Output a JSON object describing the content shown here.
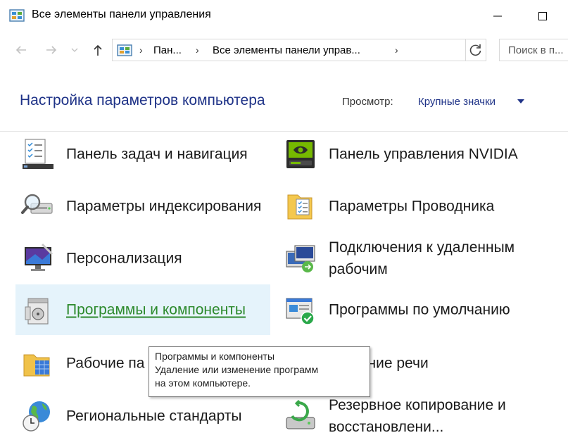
{
  "window": {
    "title": "Все элементы панели управления",
    "icon": "control-panel-icon"
  },
  "navbar": {
    "breadcrumbs": [
      "Пан...",
      "Все элементы панели управ..."
    ],
    "search_placeholder": "Поиск в п..."
  },
  "header": {
    "title": "Настройка параметров компьютера",
    "view_label": "Просмотр:",
    "view_value": "Крупные значки"
  },
  "items_left": [
    {
      "label": "Панель задач и навигация",
      "icon": "taskbar-icon"
    },
    {
      "label": "Параметры индексирования",
      "icon": "indexing-icon"
    },
    {
      "label": "Персонализация",
      "icon": "personalization-icon"
    },
    {
      "label": "Программы и компоненты",
      "icon": "programs-icon"
    },
    {
      "label": "Рабочие па",
      "icon": "work-folders-icon"
    },
    {
      "label": "Региональные стандарты",
      "icon": "region-icon"
    }
  ],
  "items_right": [
    {
      "label": "Панель управления NVIDIA",
      "icon": "nvidia-icon"
    },
    {
      "label": "Параметры Проводника",
      "icon": "explorer-options-icon"
    },
    {
      "label": "Подключения к удаленным рабочим",
      "icon": "remote-desktop-icon"
    },
    {
      "label": "Программы по умолчанию",
      "icon": "default-programs-icon"
    },
    {
      "label": "знавание речи",
      "icon": "speech-icon"
    },
    {
      "label": "Резервное копирование и восстановлени...",
      "icon": "backup-icon"
    }
  ],
  "tooltip": {
    "line1": "Программы и компоненты",
    "line2": "Удаление или изменение программ",
    "line3": "на этом компьютере."
  },
  "colors": {
    "accent": "#1e3287",
    "hover_bg": "#e5f3fb",
    "link_hover": "#2d8a2d"
  }
}
